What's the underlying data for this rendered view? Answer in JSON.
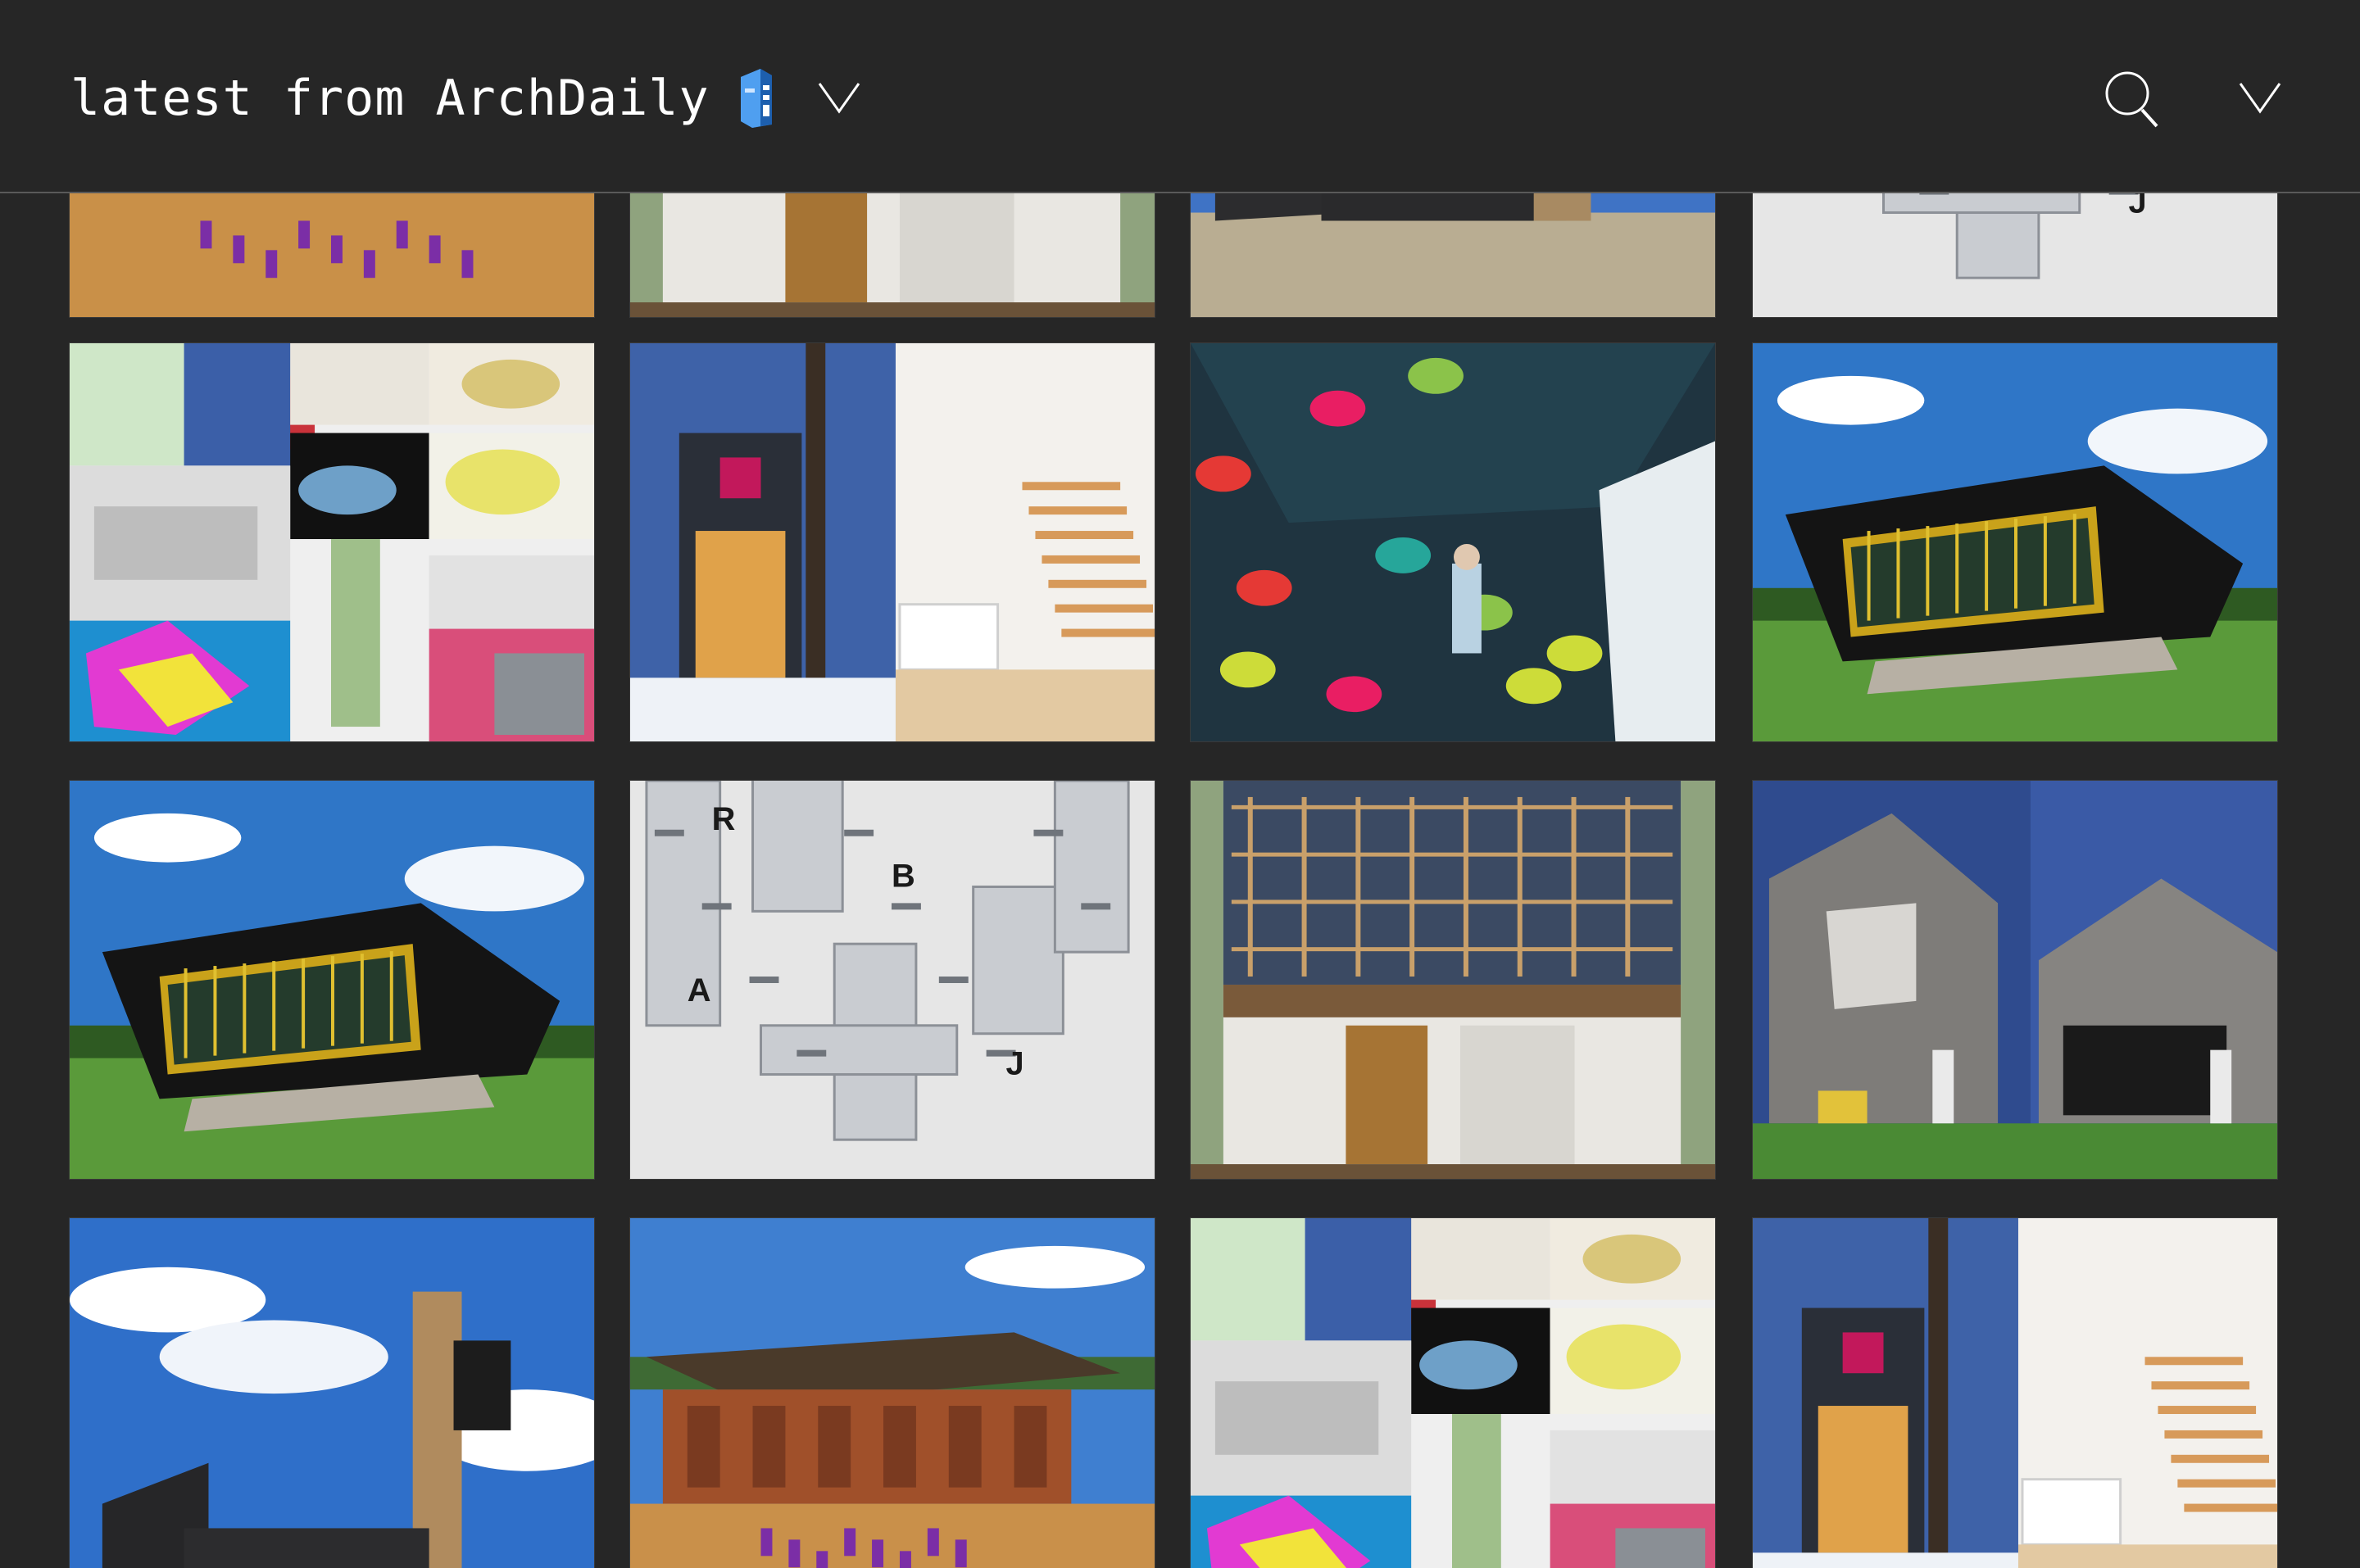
{
  "header": {
    "title": "latest from ArchDaily",
    "logo_icon": "archdaily-building-logo",
    "feed_chevron_icon": "chevron-down-icon",
    "search_icon": "search-icon",
    "menu_chevron_icon": "chevron-down-icon"
  },
  "colors": {
    "background": "#262626",
    "header_divider": "#5a5a5a",
    "title_text": "#ffffff",
    "logo_blue": "#2a7fd9"
  },
  "feed": {
    "columns": 4,
    "tiles": [
      {
        "row": 0,
        "col": 0,
        "subject": "school-children-courtyard"
      },
      {
        "row": 0,
        "col": 1,
        "subject": "timber-house-facade"
      },
      {
        "row": 0,
        "col": 2,
        "subject": "dark-pavilion-landscape"
      },
      {
        "row": 0,
        "col": 3,
        "subject": "alphabet-tower-models"
      },
      {
        "row": 1,
        "col": 0,
        "subject": "architecture-collage"
      },
      {
        "row": 1,
        "col": 1,
        "subject": "tree-house-winter"
      },
      {
        "row": 1,
        "col": 2,
        "subject": "climbing-wall-interior"
      },
      {
        "row": 1,
        "col": 3,
        "subject": "black-cantilever-building"
      },
      {
        "row": 2,
        "col": 0,
        "subject": "black-cantilever-building"
      },
      {
        "row": 2,
        "col": 1,
        "subject": "alphabet-tower-models"
      },
      {
        "row": 2,
        "col": 2,
        "subject": "timber-house-facade"
      },
      {
        "row": 2,
        "col": 3,
        "subject": "brick-house-garden"
      },
      {
        "row": 3,
        "col": 0,
        "subject": "timber-tower-sky"
      },
      {
        "row": 3,
        "col": 1,
        "subject": "brick-school-roof"
      },
      {
        "row": 3,
        "col": 2,
        "subject": "architecture-collage"
      },
      {
        "row": 3,
        "col": 3,
        "subject": "tree-house-winter"
      }
    ]
  }
}
